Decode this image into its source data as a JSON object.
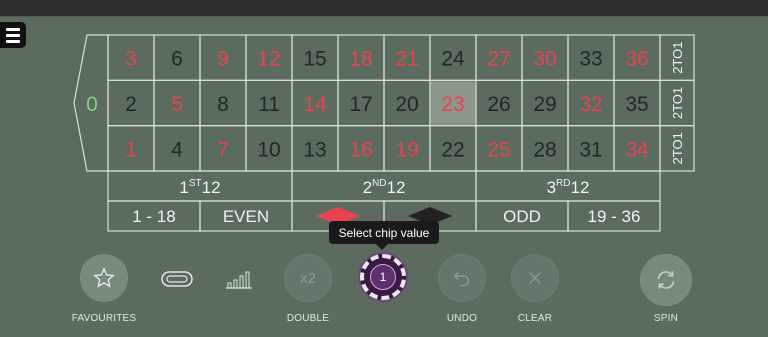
{
  "table": {
    "zero": "0",
    "rows": [
      [
        "3",
        "6",
        "9",
        "12",
        "15",
        "18",
        "21",
        "24",
        "27",
        "30",
        "33",
        "36"
      ],
      [
        "2",
        "5",
        "8",
        "11",
        "14",
        "17",
        "20",
        "23",
        "26",
        "29",
        "32",
        "35"
      ],
      [
        "1",
        "4",
        "7",
        "10",
        "13",
        "16",
        "19",
        "22",
        "25",
        "28",
        "31",
        "34"
      ]
    ],
    "red_numbers": [
      "1",
      "3",
      "5",
      "7",
      "9",
      "12",
      "14",
      "16",
      "18",
      "19",
      "21",
      "23",
      "25",
      "27",
      "30",
      "32",
      "34",
      "36"
    ],
    "highlighted": "23",
    "column_bets": [
      "2TO1",
      "2TO1",
      "2TO1"
    ],
    "dozens": [
      {
        "num": "1",
        "sup": "ST",
        "rest": "12"
      },
      {
        "num": "2",
        "sup": "ND",
        "rest": "12"
      },
      {
        "num": "3",
        "sup": "RD",
        "rest": "12"
      }
    ],
    "outside": {
      "low": "1 - 18",
      "even": "EVEN",
      "odd": "ODD",
      "high": "19 - 36"
    },
    "colors": {
      "red": "#e8434f",
      "black": "#262626",
      "zero": "#7ed27a",
      "felt": "#5b6b5e"
    }
  },
  "tooltip": "Select chip value",
  "chip": {
    "value": "1",
    "color": "#5c2f6f"
  },
  "controls": {
    "favourites": "FAVOURITES",
    "double": "DOUBLE",
    "double_icon": "x2",
    "undo": "UNDO",
    "clear": "CLEAR",
    "spin": "SPIN"
  },
  "icons": [
    "menu-icon",
    "star-icon",
    "racetrack-icon",
    "stats-icon",
    "double-icon",
    "undo-icon",
    "clear-icon",
    "spin-icon"
  ]
}
